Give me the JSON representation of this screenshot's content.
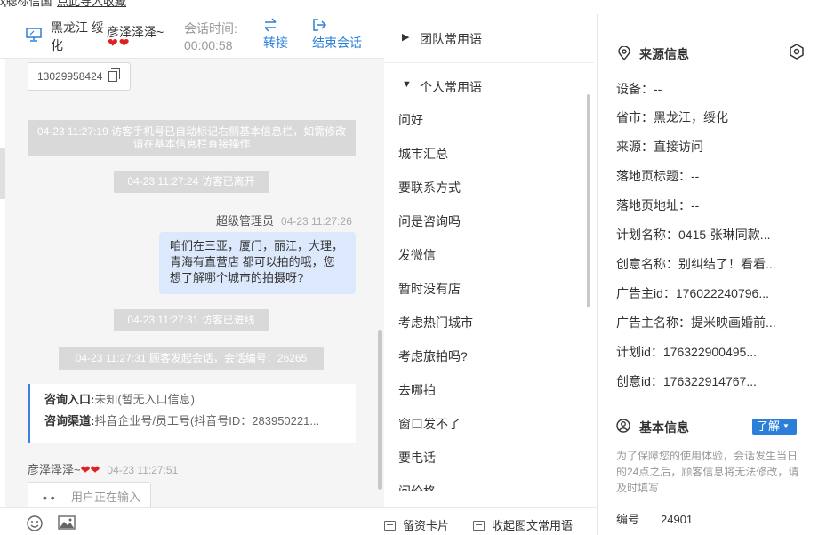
{
  "top_strip": {
    "text1": "ҳ聪标信国",
    "text2": "点此导入收藏"
  },
  "header": {
    "location": "黑龙江 绥化",
    "user_name": "彦泽泽泽~",
    "hearts": "❤❤",
    "time_label": "会话时间:",
    "time_value": "00:00:58",
    "transfer_label": "转接",
    "end_label": "结束会话"
  },
  "chat": {
    "phone": "13029958424",
    "sys1": "04-23 11:27:19 访客手机号已自动标记右侧基本信息栏，如需修改请在基本信息栏直接操作",
    "sys2": "04-23 11:27:24 访客已离开",
    "agent_name": "超级管理员",
    "agent_time": "04-23 11:27:26",
    "agent_message": "咱们在三亚，厦门，丽江，大理，青海有直营店 都可以拍的哦，您想了解哪个城市的拍摄呀?",
    "sys3": "04-23 11:27:31 访客已进线",
    "sys4": "04-23 11:27:31 顾客发起会话，会话编号：26265",
    "card": {
      "entry_label": "咨询入口:",
      "entry_value": "未知(暂无入口信息)",
      "channel_label": "咨询渠道:",
      "channel_value": "抖音企业号/员工号(抖音号ID：283950221..."
    },
    "visitor_name": "彦泽泽泽~",
    "visitor_hearts": "❤❤",
    "visitor_time": "04-23 11:27:51",
    "typing_text": "用户正在输入",
    "typing_dots": "• •"
  },
  "middle": {
    "team_group": "团队常用语",
    "personal_group": "个人常用语",
    "phrases": [
      "问好",
      "城市汇总",
      "要联系方式",
      "问是咨询吗",
      "发微信",
      "暂时没有店",
      "考虑热门城市",
      "考虑旅拍吗?",
      "去哪拍",
      "窗口发不了",
      "要电话",
      "问价格"
    ],
    "card_button": "留资卡片",
    "fav_button": "收起图文常用语"
  },
  "right": {
    "source_title": "来源信息",
    "device": "设备：--",
    "province": "省市：黑龙江，绥化",
    "source": "来源：直接访问",
    "landing_title": "落地页标题：--",
    "landing_url": "落地页地址：--",
    "plan_name": "计划名称：0415-张琳同款...",
    "creative_name": "创意名称：别纠结了！看看...",
    "advertiser_id": "广告主id：176022240796...",
    "advertiser_name": "广告主名称：提米映画婚前...",
    "plan_id": "计划id：176322900495...",
    "creative_id": "创意id：176322914767...",
    "basic_title": "基本信息",
    "learn_more": "了解",
    "notice": "为了保障您的使用体验，会话发生当日的24点之后，顾客信息将无法修改，请及时填写",
    "code_label": "编号",
    "code_value": "24901"
  },
  "colors": {
    "accent": "#2b7fd9",
    "agent_bubble": "#dce8fb",
    "system_bg": "#d9d9d9",
    "heart": "#e02020"
  }
}
